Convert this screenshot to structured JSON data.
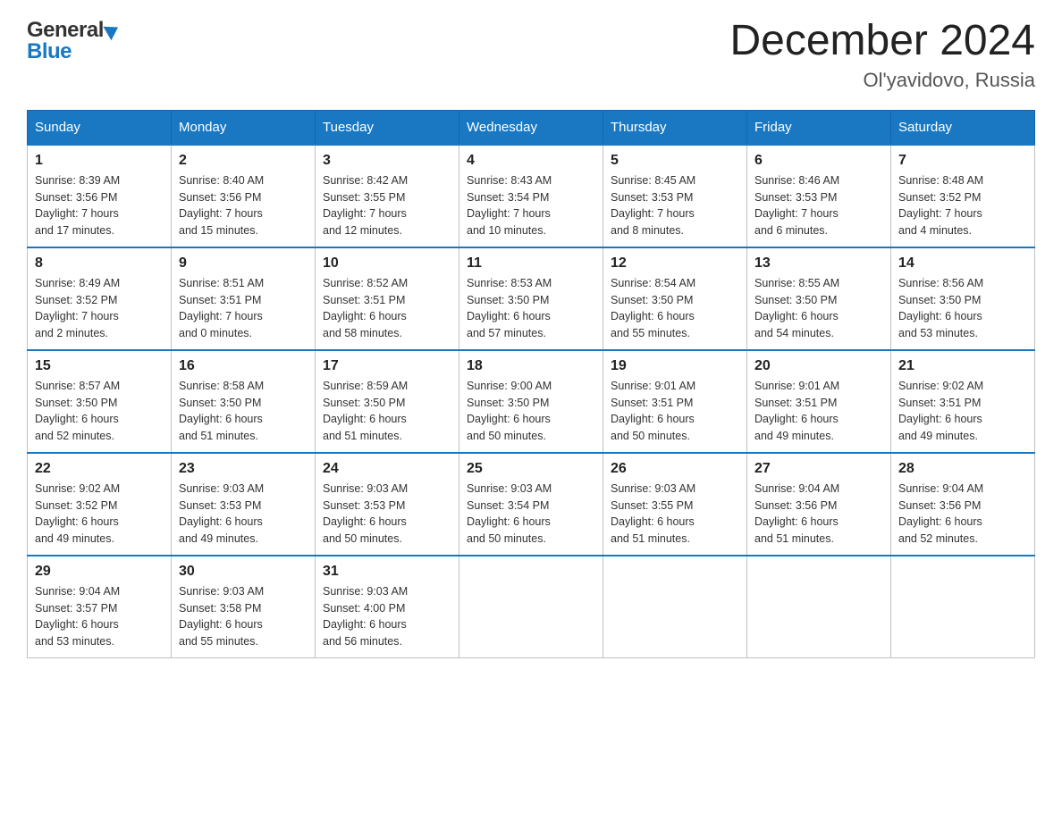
{
  "header": {
    "month_title": "December 2024",
    "location": "Ol'yavidovo, Russia"
  },
  "days_of_week": [
    "Sunday",
    "Monday",
    "Tuesday",
    "Wednesday",
    "Thursday",
    "Friday",
    "Saturday"
  ],
  "weeks": [
    [
      {
        "day": "1",
        "sunrise": "8:39 AM",
        "sunset": "3:56 PM",
        "daylight": "7 hours and 17 minutes."
      },
      {
        "day": "2",
        "sunrise": "8:40 AM",
        "sunset": "3:56 PM",
        "daylight": "7 hours and 15 minutes."
      },
      {
        "day": "3",
        "sunrise": "8:42 AM",
        "sunset": "3:55 PM",
        "daylight": "7 hours and 12 minutes."
      },
      {
        "day": "4",
        "sunrise": "8:43 AM",
        "sunset": "3:54 PM",
        "daylight": "7 hours and 10 minutes."
      },
      {
        "day": "5",
        "sunrise": "8:45 AM",
        "sunset": "3:53 PM",
        "daylight": "7 hours and 8 minutes."
      },
      {
        "day": "6",
        "sunrise": "8:46 AM",
        "sunset": "3:53 PM",
        "daylight": "7 hours and 6 minutes."
      },
      {
        "day": "7",
        "sunrise": "8:48 AM",
        "sunset": "3:52 PM",
        "daylight": "7 hours and 4 minutes."
      }
    ],
    [
      {
        "day": "8",
        "sunrise": "8:49 AM",
        "sunset": "3:52 PM",
        "daylight": "7 hours and 2 minutes."
      },
      {
        "day": "9",
        "sunrise": "8:51 AM",
        "sunset": "3:51 PM",
        "daylight": "7 hours and 0 minutes."
      },
      {
        "day": "10",
        "sunrise": "8:52 AM",
        "sunset": "3:51 PM",
        "daylight": "6 hours and 58 minutes."
      },
      {
        "day": "11",
        "sunrise": "8:53 AM",
        "sunset": "3:50 PM",
        "daylight": "6 hours and 57 minutes."
      },
      {
        "day": "12",
        "sunrise": "8:54 AM",
        "sunset": "3:50 PM",
        "daylight": "6 hours and 55 minutes."
      },
      {
        "day": "13",
        "sunrise": "8:55 AM",
        "sunset": "3:50 PM",
        "daylight": "6 hours and 54 minutes."
      },
      {
        "day": "14",
        "sunrise": "8:56 AM",
        "sunset": "3:50 PM",
        "daylight": "6 hours and 53 minutes."
      }
    ],
    [
      {
        "day": "15",
        "sunrise": "8:57 AM",
        "sunset": "3:50 PM",
        "daylight": "6 hours and 52 minutes."
      },
      {
        "day": "16",
        "sunrise": "8:58 AM",
        "sunset": "3:50 PM",
        "daylight": "6 hours and 51 minutes."
      },
      {
        "day": "17",
        "sunrise": "8:59 AM",
        "sunset": "3:50 PM",
        "daylight": "6 hours and 51 minutes."
      },
      {
        "day": "18",
        "sunrise": "9:00 AM",
        "sunset": "3:50 PM",
        "daylight": "6 hours and 50 minutes."
      },
      {
        "day": "19",
        "sunrise": "9:01 AM",
        "sunset": "3:51 PM",
        "daylight": "6 hours and 50 minutes."
      },
      {
        "day": "20",
        "sunrise": "9:01 AM",
        "sunset": "3:51 PM",
        "daylight": "6 hours and 49 minutes."
      },
      {
        "day": "21",
        "sunrise": "9:02 AM",
        "sunset": "3:51 PM",
        "daylight": "6 hours and 49 minutes."
      }
    ],
    [
      {
        "day": "22",
        "sunrise": "9:02 AM",
        "sunset": "3:52 PM",
        "daylight": "6 hours and 49 minutes."
      },
      {
        "day": "23",
        "sunrise": "9:03 AM",
        "sunset": "3:53 PM",
        "daylight": "6 hours and 49 minutes."
      },
      {
        "day": "24",
        "sunrise": "9:03 AM",
        "sunset": "3:53 PM",
        "daylight": "6 hours and 50 minutes."
      },
      {
        "day": "25",
        "sunrise": "9:03 AM",
        "sunset": "3:54 PM",
        "daylight": "6 hours and 50 minutes."
      },
      {
        "day": "26",
        "sunrise": "9:03 AM",
        "sunset": "3:55 PM",
        "daylight": "6 hours and 51 minutes."
      },
      {
        "day": "27",
        "sunrise": "9:04 AM",
        "sunset": "3:56 PM",
        "daylight": "6 hours and 51 minutes."
      },
      {
        "day": "28",
        "sunrise": "9:04 AM",
        "sunset": "3:56 PM",
        "daylight": "6 hours and 52 minutes."
      }
    ],
    [
      {
        "day": "29",
        "sunrise": "9:04 AM",
        "sunset": "3:57 PM",
        "daylight": "6 hours and 53 minutes."
      },
      {
        "day": "30",
        "sunrise": "9:03 AM",
        "sunset": "3:58 PM",
        "daylight": "6 hours and 55 minutes."
      },
      {
        "day": "31",
        "sunrise": "9:03 AM",
        "sunset": "4:00 PM",
        "daylight": "6 hours and 56 minutes."
      },
      null,
      null,
      null,
      null
    ]
  ],
  "labels": {
    "sunrise": "Sunrise:",
    "sunset": "Sunset:",
    "daylight": "Daylight:"
  }
}
